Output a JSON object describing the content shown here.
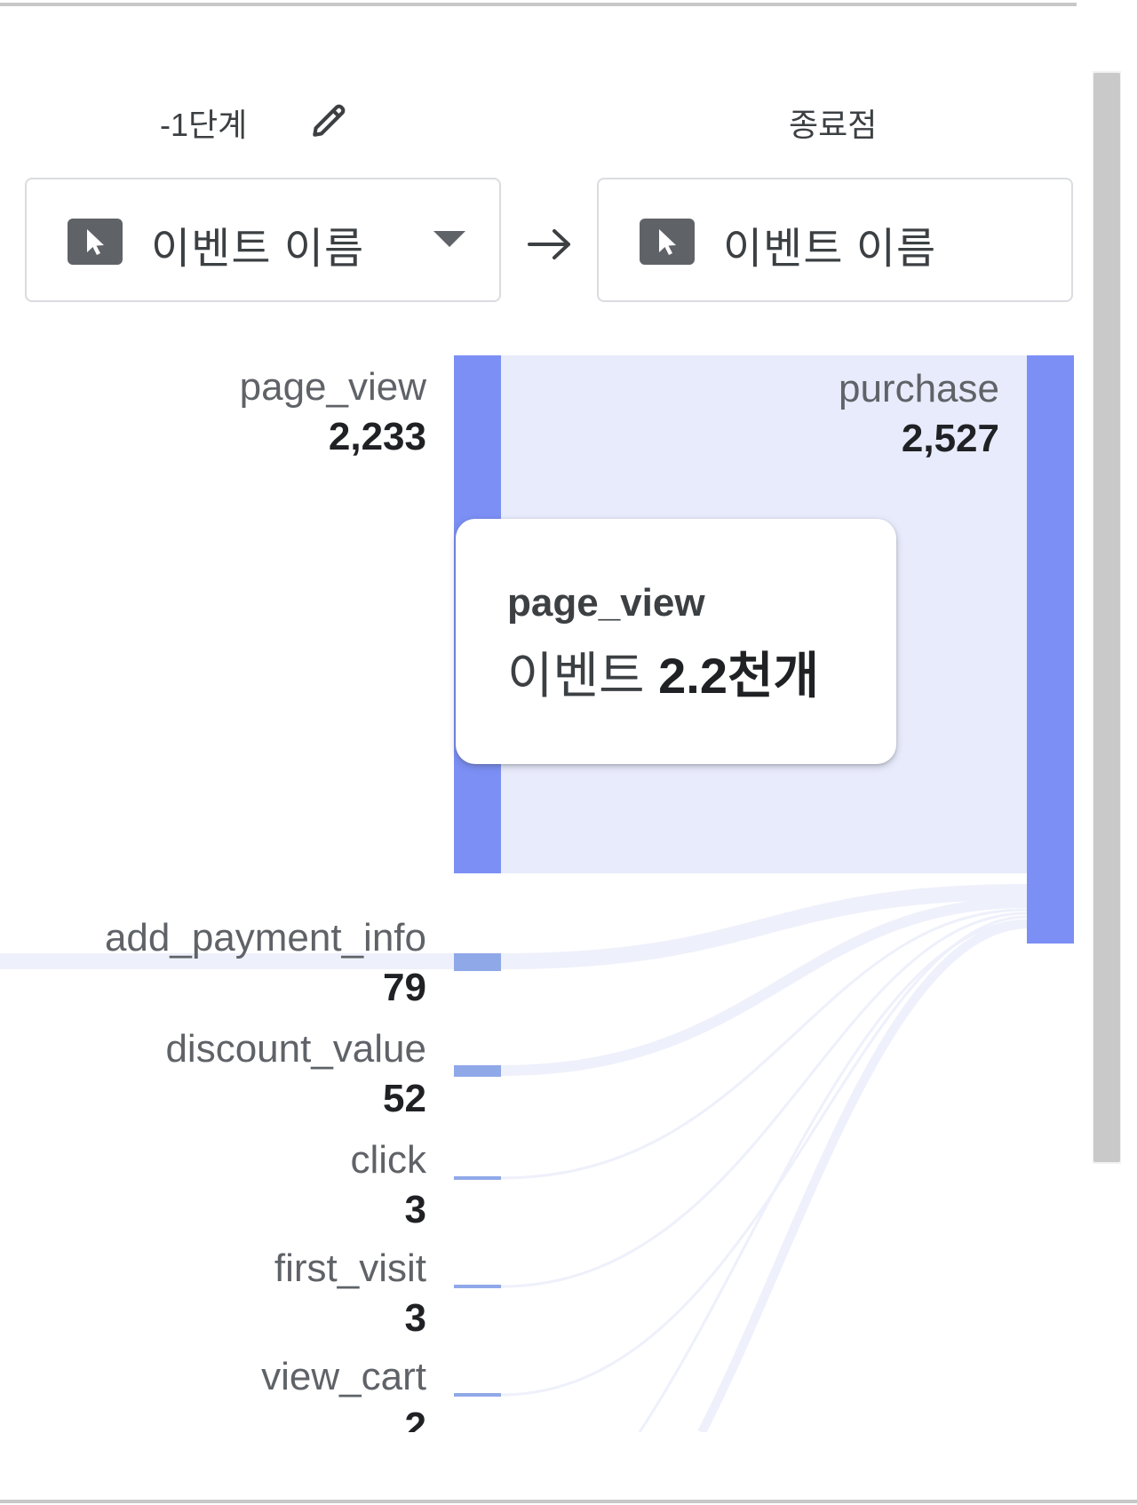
{
  "header": {
    "step_label": "-1단계",
    "end_label": "종료점"
  },
  "dropdowns": {
    "left_text": "이벤트 이름",
    "right_text": "이벤트 이름"
  },
  "icons": {
    "edit": "pencil-icon",
    "event": "cursor-click-icon",
    "caret": "caret-down-icon",
    "arrow": "arrow-right-icon"
  },
  "colors": {
    "node": "#7b8ff5",
    "node_light": "#8fa8e8",
    "flow": "#e8ebfb",
    "flow_faint": "#eef0fb"
  },
  "flow": {
    "end_node": {
      "name": "purchase",
      "count": "2,527"
    },
    "sources": [
      {
        "name": "page_view",
        "count": "2,233"
      },
      {
        "name": "add_payment_info",
        "count": "79"
      },
      {
        "name": "discount_value",
        "count": "52"
      },
      {
        "name": "click",
        "count": "3"
      },
      {
        "name": "first_visit",
        "count": "3"
      },
      {
        "name": "view_cart",
        "count": "2"
      }
    ]
  },
  "tooltip": {
    "title": "page_view",
    "value_prefix": "이벤트",
    "value": "2.2천개"
  }
}
